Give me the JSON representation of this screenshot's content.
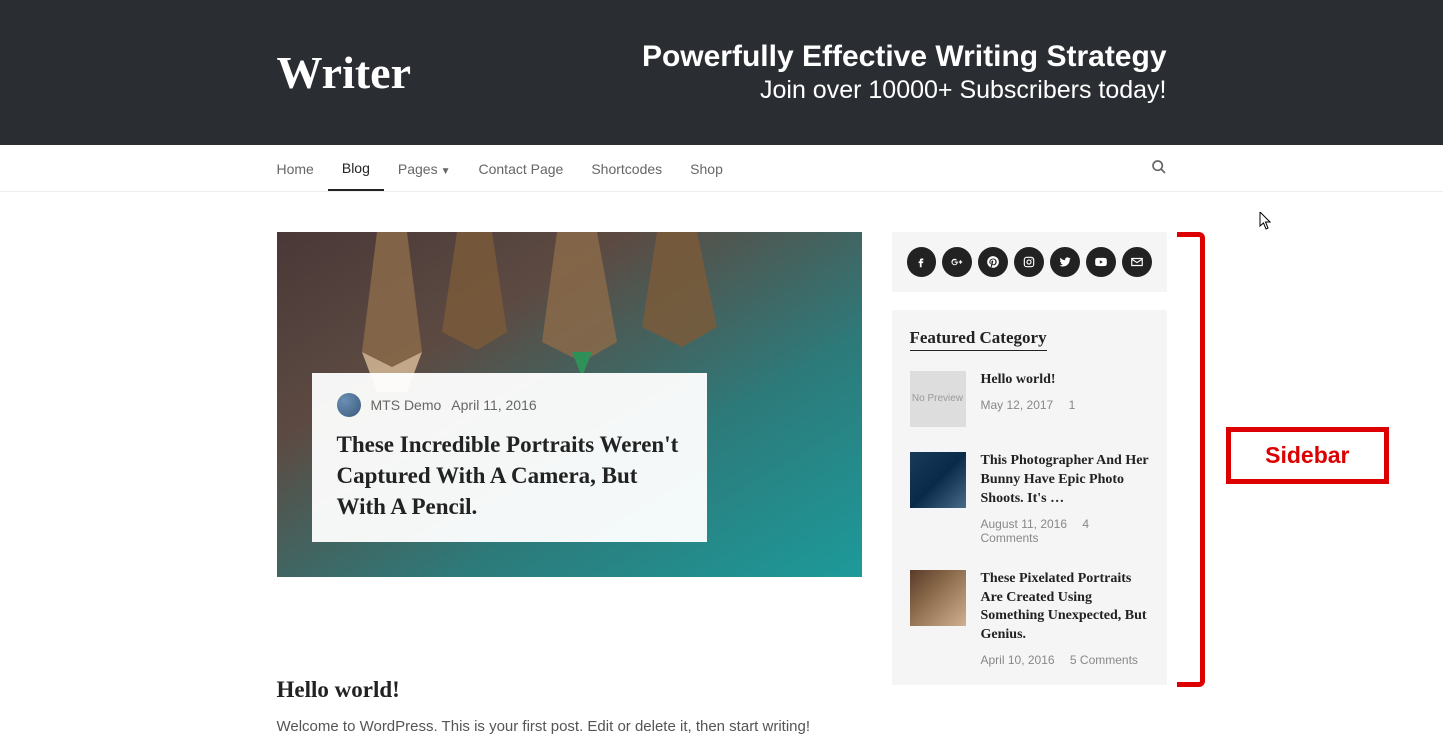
{
  "site_title": "Writer",
  "header": {
    "heading": "Powerfully Effective Writing Strategy",
    "subheading": "Join over 10000+ Subscribers today!"
  },
  "nav": [
    {
      "label": "Home",
      "active": false,
      "dropdown": false
    },
    {
      "label": "Blog",
      "active": true,
      "dropdown": false
    },
    {
      "label": "Pages",
      "active": false,
      "dropdown": true
    },
    {
      "label": "Contact Page",
      "active": false,
      "dropdown": false
    },
    {
      "label": "Shortcodes",
      "active": false,
      "dropdown": false
    },
    {
      "label": "Shop",
      "active": false,
      "dropdown": false
    }
  ],
  "hero": {
    "author": "MTS Demo",
    "date": "April 11, 2016",
    "title": "These Incredible Portraits Weren't Captured With A Camera, But With A Pencil."
  },
  "post2": {
    "title": "Hello world!",
    "excerpt": "Welcome to WordPress. This is your first post. Edit or delete it, then start writing!"
  },
  "sidebar": {
    "social": [
      "facebook",
      "google-plus",
      "pinterest",
      "instagram",
      "twitter",
      "youtube",
      "email"
    ],
    "featured_heading": "Featured Category",
    "featured": [
      {
        "title": "Hello world!",
        "date": "May 12, 2017",
        "comments": "1",
        "thumb": "no-preview",
        "thumb_text": "No\nPreview"
      },
      {
        "title": "This Photographer And Her Bunny Have Epic Photo Shoots. It's …",
        "date": "August 11, 2016",
        "comments": "4 Comments",
        "thumb": "photo"
      },
      {
        "title": "These Pixelated Portraits Are Created Using Something Unexpected, But Genius.",
        "date": "April 10, 2016",
        "comments": "5 Comments",
        "thumb": "coffee"
      }
    ]
  },
  "annotation": {
    "label": "Sidebar",
    "color": "#d00"
  }
}
